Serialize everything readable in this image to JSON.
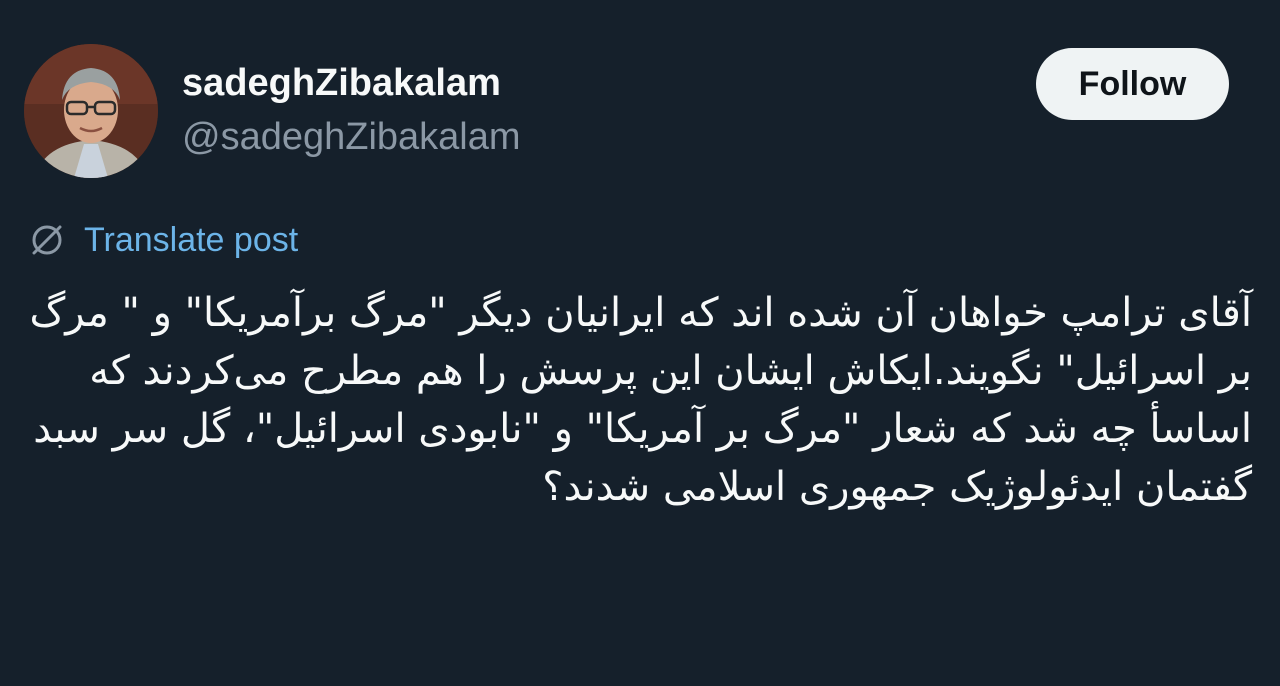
{
  "author": {
    "display_name": "sadeghZibakalam",
    "handle": "@sadeghZibakalam"
  },
  "actions": {
    "follow_label": "Follow"
  },
  "translate": {
    "label": "Translate post",
    "icon": "globe-icon"
  },
  "post": {
    "text": "آقای ترامپ خواهان آن شده اند که ایرانیان دیگر \"مرگ برآمریکا\" و \" مرگ بر اسرائیل\" نگویند.ایکاش ایشان این پرسش را هم مطرح می‌کردند که اساسأ چه شد که شعار \"مرگ بر آمریکا\" و \"نابودی اسرائیل\"، گل سر سبد گفتمان ایدئولوژیک جمهوری اسلامی شدند؟"
  },
  "colors": {
    "background": "#15202b",
    "text_primary": "#f7f9f9",
    "text_secondary": "#8b98a5",
    "link": "#6cb4e8",
    "follow_bg": "#eff3f4"
  }
}
